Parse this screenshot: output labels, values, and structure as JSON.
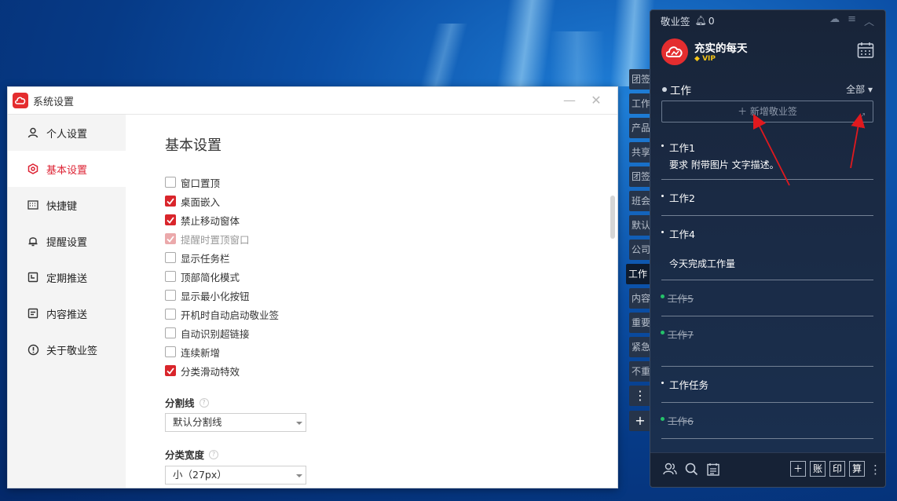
{
  "settings": {
    "title": "系统设置",
    "sidebar": [
      {
        "label": "个人设置",
        "icon": "user-icon"
      },
      {
        "label": "基本设置",
        "icon": "settings-hex-icon",
        "active": true
      },
      {
        "label": "快捷键",
        "icon": "keyboard-icon"
      },
      {
        "label": "提醒设置",
        "icon": "bell-icon"
      },
      {
        "label": "定期推送",
        "icon": "calendar-clock-icon"
      },
      {
        "label": "内容推送",
        "icon": "document-icon"
      },
      {
        "label": "关于敬业签",
        "icon": "info-icon"
      }
    ],
    "content_title": "基本设置",
    "options": [
      {
        "label": "窗口置顶",
        "checked": false
      },
      {
        "label": "桌面嵌入",
        "checked": true
      },
      {
        "label": "禁止移动窗体",
        "checked": true
      },
      {
        "label": "提醒时置顶窗口",
        "checked": true,
        "disabled": true
      },
      {
        "label": "显示任务栏",
        "checked": false
      },
      {
        "label": "顶部简化模式",
        "checked": false
      },
      {
        "label": "显示最小化按钮",
        "checked": false
      },
      {
        "label": "开机时自动启动敬业签",
        "checked": false
      },
      {
        "label": "自动识别超链接",
        "checked": false
      },
      {
        "label": "连续新增",
        "checked": false
      },
      {
        "label": "分类滑动特效",
        "checked": true
      }
    ],
    "divider_label": "分割线",
    "divider_value": "默认分割线",
    "width_label": "分类宽度",
    "width_value": "小（27px）"
  },
  "vtabs": [
    "团签",
    "工作",
    "产品",
    "共享",
    "团签",
    "班会",
    "默认",
    "公司",
    "工作",
    "内容",
    "重要",
    "紧急",
    "不重"
  ],
  "widget": {
    "app_name": "敬业签",
    "notif_count": "0",
    "username": "充实的每天",
    "vip": "VIP",
    "category": "工作",
    "filter": "全部",
    "new_label": "新增敬业签",
    "notes": [
      {
        "title": "工作1",
        "body": "要求  附带图片 文字描述。",
        "done": false
      },
      {
        "title": "工作2",
        "body": "",
        "done": false
      },
      {
        "title": "工作4",
        "body": "今天完成工作量",
        "done": false
      },
      {
        "title": "工作5",
        "body": "",
        "done": true
      },
      {
        "title": "工作7",
        "body": "",
        "done": true
      },
      {
        "title": "工作任务",
        "body": "",
        "done": false
      },
      {
        "title": "工作6",
        "body": "",
        "done": true
      }
    ],
    "bottom_buttons": [
      "账",
      "印",
      "算"
    ]
  },
  "colors": {
    "accent": "#d9252b",
    "panel_bg": "#182438",
    "done_dot": "#25c26a"
  }
}
